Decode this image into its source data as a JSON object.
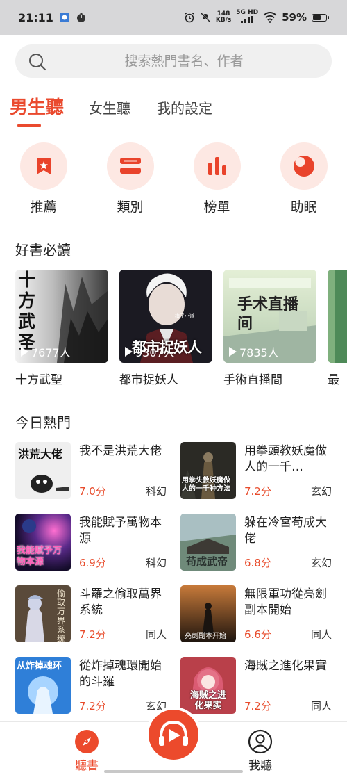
{
  "status_bar": {
    "time": "21:11",
    "network_speed_value": "148",
    "network_speed_unit": "KB/s",
    "network_type": "5G HD",
    "battery": "59%",
    "battery_level": 0.59
  },
  "search": {
    "placeholder": "搜索熱門書名、作者"
  },
  "tabs": [
    {
      "label": "男生聽",
      "active": true
    },
    {
      "label": "女生聽",
      "active": false
    },
    {
      "label": "我的設定",
      "active": false
    }
  ],
  "quick_nav": [
    {
      "label": "推薦",
      "icon": "bookmark-star-icon"
    },
    {
      "label": "類別",
      "icon": "category-bars-icon"
    },
    {
      "label": "榜單",
      "icon": "chart-bars-icon"
    },
    {
      "label": "助眠",
      "icon": "moon-icon"
    }
  ],
  "must_read": {
    "title": "好書必讀",
    "books": [
      {
        "title": "十方武聖",
        "listeners": "7677人",
        "cover_text": "十方武圣"
      },
      {
        "title": "都市捉妖人",
        "listeners": "9307人",
        "cover_text": "都市捉妖人",
        "cover_subtext": "梅子小道"
      },
      {
        "title": "手術直播間",
        "listeners": "7835人",
        "cover_text": "手术直播间"
      },
      {
        "title": "最"
      }
    ]
  },
  "hot_today": {
    "title": "今日熱門",
    "items": [
      {
        "title": "我不是洪荒大佬",
        "score": "7.0分",
        "genre": "科幻",
        "cover_text": "洪荒大佬"
      },
      {
        "title": "用拳頭教妖魔做人的一千…",
        "score": "7.2分",
        "genre": "玄幻",
        "cover_text": "用拳头教妖魔做人的一千种方法"
      },
      {
        "title": "我能賦予萬物本源",
        "score": "6.9分",
        "genre": "科幻",
        "cover_text": "我能赋予万物本源"
      },
      {
        "title": "躲在冷宮苟成大佬",
        "score": "6.8分",
        "genre": "玄幻",
        "cover_text": "苟成武帝"
      },
      {
        "title": "斗羅之偷取萬界系統",
        "score": "7.2分",
        "genre": "同人",
        "cover_text": "偷取万界系统"
      },
      {
        "title": "無限軍功從亮劍副本開始",
        "score": "6.6分",
        "genre": "同人",
        "cover_text": "亮剑副本开始"
      },
      {
        "title": "從炸掉魂環開始的斗羅",
        "score": "7.2分",
        "genre": "玄幻",
        "cover_text": "从炸掉魂环"
      },
      {
        "title": "海賊之進化果實",
        "score": "7.2分",
        "genre": "同人",
        "cover_text": "海贼之进化果实"
      }
    ]
  },
  "bottom_nav": {
    "left": {
      "label": "聽書",
      "icon": "compass-icon",
      "active": true
    },
    "center": {
      "icon": "headphones-play-icon"
    },
    "right": {
      "label": "我聽",
      "icon": "user-icon",
      "active": false
    }
  },
  "colors": {
    "accent": "#ea4a2e",
    "accent_light": "#fde8e3",
    "score": "#e84c2c"
  }
}
